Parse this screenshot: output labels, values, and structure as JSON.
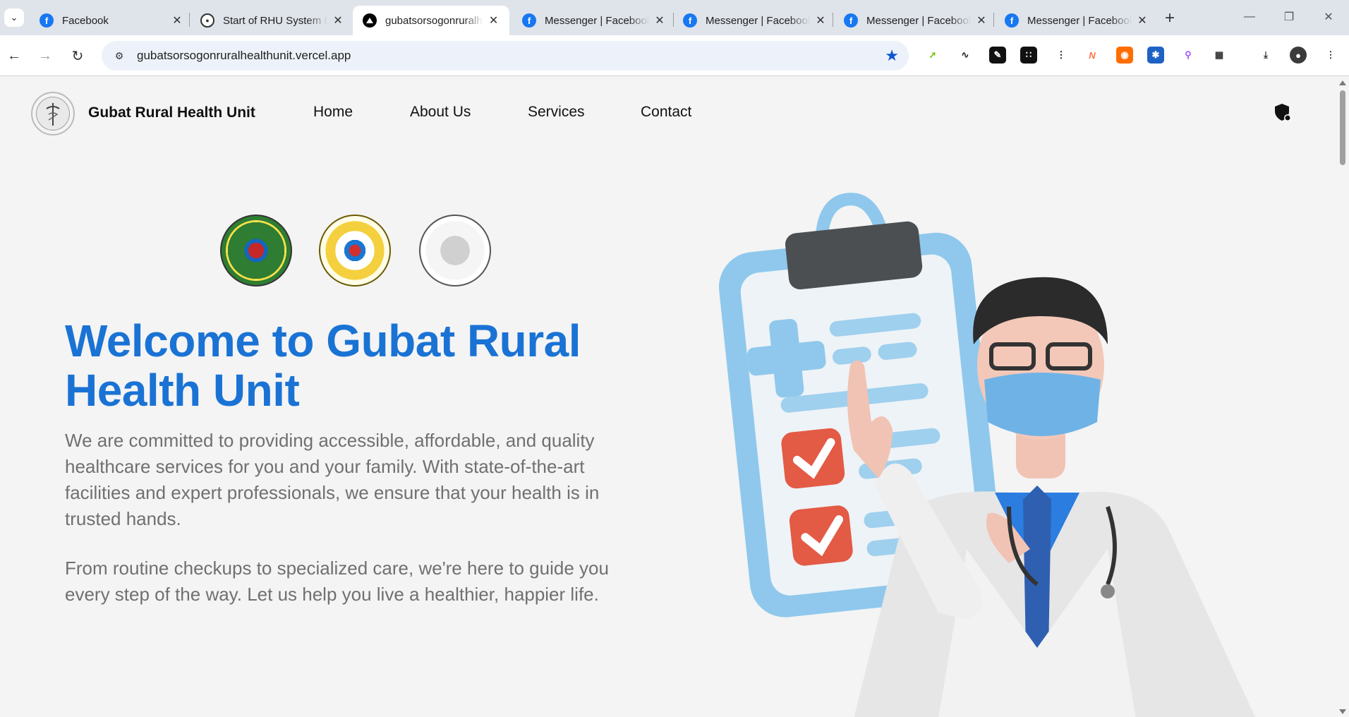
{
  "browser": {
    "tabs": [
      {
        "title": "Facebook",
        "favicon": "facebook-icon"
      },
      {
        "title": "Start of RHU System Development",
        "favicon": "rhu-icon"
      },
      {
        "title": "gubatsorsogonruralhealthunit",
        "favicon": "vercel-icon",
        "active": true
      },
      {
        "title": "Messenger | Facebook",
        "favicon": "facebook-icon"
      },
      {
        "title": "Messenger | Facebook",
        "favicon": "facebook-icon"
      },
      {
        "title": "Messenger | Facebook",
        "favicon": "facebook-icon"
      },
      {
        "title": "Messenger | Facebook",
        "favicon": "facebook-icon"
      }
    ],
    "url": "gubatsorsogonruralhealthunit.vercel.app",
    "bookmarked": true,
    "accent_color": "#0b57d0"
  },
  "site": {
    "brand": "Gubat Rural Health Unit",
    "nav": {
      "home": "Home",
      "about": "About Us",
      "services": "Services",
      "contact": "Contact"
    },
    "seals": [
      "department-of-health-seal",
      "bayan-ng-gubat-seal",
      "municipal-health-office-seal"
    ],
    "hero": {
      "title": "Welcome to Gubat Rural Health Unit",
      "paragraph1": "We are committed to providing accessible, affordable, and quality healthcare services for you and your family. With state-of-the-art facilities and expert professionals, we ensure that your health is in trusted hands.",
      "paragraph2": "From routine checkups to specialized care, we're here to guide you every step of the way. Let us help you live a healthier, happier life."
    },
    "colors": {
      "title": "#1a73d4",
      "text": "#707070",
      "background": "#f4f4f4"
    }
  }
}
